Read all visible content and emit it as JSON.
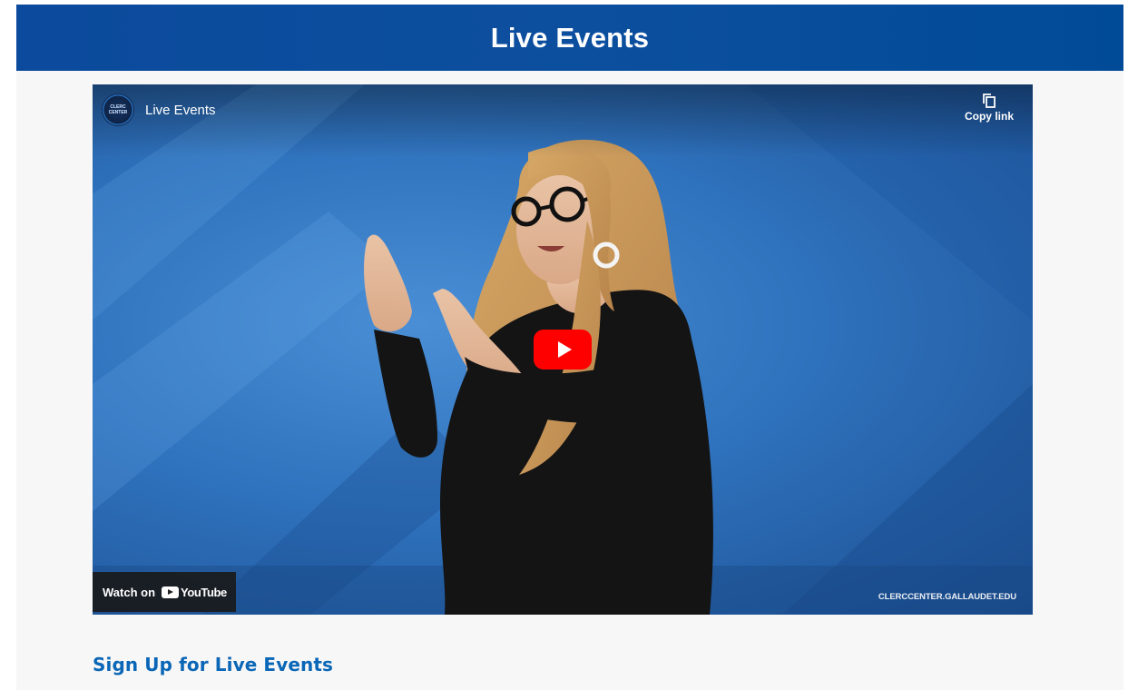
{
  "header": {
    "title": "Live Events"
  },
  "video": {
    "channel_avatar_text": "CLERC CENTER",
    "title": "Live Events",
    "copy_link_label": "Copy link",
    "watch_on_label": "Watch on",
    "youtube_wordmark": "YouTube",
    "watermark": "CLERCCENTER.GALLAUDET.EDU",
    "icons": {
      "play": "play-button-icon",
      "copy": "copy-link-icon",
      "youtube": "youtube-logo-icon"
    }
  },
  "links": {
    "signup": "Sign Up for Live Events"
  },
  "colors": {
    "banner": "#0b4a9c",
    "link": "#0a66b7",
    "play_button": "#ff0000"
  }
}
